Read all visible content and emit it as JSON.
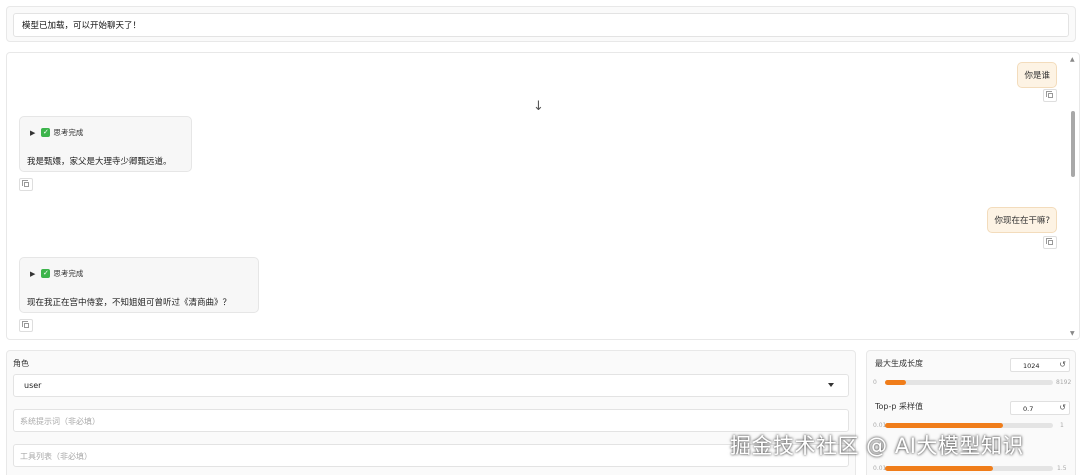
{
  "status": {
    "text": "模型已加载，可以开始聊天了！"
  },
  "chat": {
    "messages": [
      {
        "role": "user",
        "text": "你是谁"
      },
      {
        "role": "assistant",
        "thinking_label": "思考完成",
        "text": "我是甄嬛，家父是大理寺少卿甄远道。"
      },
      {
        "role": "user",
        "text": "你现在在干嘛?"
      },
      {
        "role": "assistant",
        "thinking_label": "思考完成",
        "text": "现在我正在宫中侍宴，不知姐姐可曾听过《清商曲》？"
      }
    ]
  },
  "controls": {
    "role_label": "角色",
    "role_value": "user",
    "system_prompt_placeholder": "系统提示词（非必填）",
    "tools_placeholder": "工具列表（非必填）"
  },
  "params": {
    "max_length": {
      "label": "最大生成长度",
      "value": "1024",
      "min": "0",
      "max": "8192",
      "fraction": 0.125
    },
    "top_p": {
      "label": "Top-p 采样值",
      "value": "0.7",
      "min": "0.01",
      "max": "1",
      "fraction": 0.7
    },
    "temperature": {
      "min": "0.01",
      "max": "1.5",
      "fraction": 0.64
    }
  },
  "watermark": "掘金技术社区 @ AI大模型知识"
}
